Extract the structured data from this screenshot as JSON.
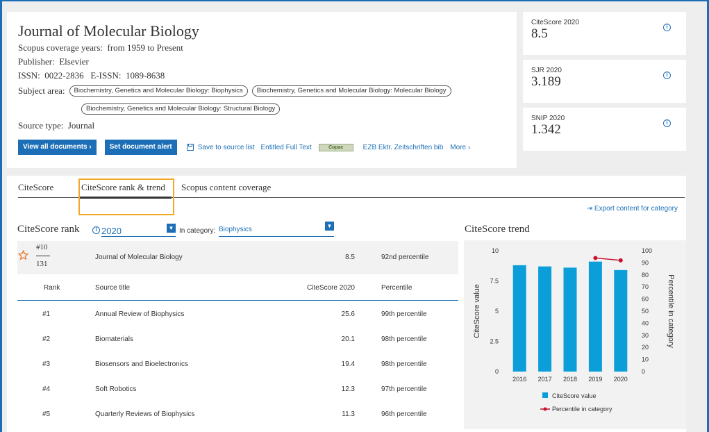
{
  "source": {
    "title": "Journal of Molecular Biology",
    "coverage_label": "Scopus coverage years:",
    "coverage_value": "from 1959 to Present",
    "publisher_label": "Publisher:",
    "publisher_value": "Elsevier",
    "issn_label": "ISSN:",
    "issn_value": "0022-2836",
    "eissn_label": "E-ISSN:",
    "eissn_value": "1089-8638",
    "subject_label": "Subject area:",
    "subjects": [
      "Biochemistry, Genetics and Molecular Biology: Biophysics",
      "Biochemistry, Genetics and Molecular Biology: Molecular Biology",
      "Biochemistry, Genetics and Molecular Biology: Structural Biology"
    ],
    "source_type_label": "Source type:",
    "source_type_value": "Journal"
  },
  "actions": {
    "view_all": "View all documents ›",
    "set_alert": "Set document alert",
    "save_to_list": "Save to source list",
    "entitled_full_text": "Entitled Full Text",
    "copac": "Copac",
    "ezb": "EZB Ektr. Zeitschriften bib",
    "more": "More ›"
  },
  "metrics": [
    {
      "label": "CiteScore 2020",
      "value": "8.5"
    },
    {
      "label": "SJR 2020",
      "value": "3.189"
    },
    {
      "label": "SNIP 2020",
      "value": "1.342"
    }
  ],
  "tabs": [
    "CiteScore",
    "CiteScore rank & trend",
    "Scopus content coverage"
  ],
  "export_link": "Export content for category",
  "rank": {
    "title": "CiteScore rank",
    "year": "2020",
    "category_label": "In category:",
    "category_value": "Biophysics",
    "current": {
      "rank": "#10",
      "total": "131",
      "title": "Journal of Molecular Biology",
      "score": "8.5",
      "percentile": "92nd percentile"
    },
    "headers": {
      "rank": "Rank",
      "title": "Source title",
      "score": "CiteScore 2020",
      "percentile": "Percentile"
    },
    "rows": [
      {
        "rank": "#1",
        "title": "Annual Review of Biophysics",
        "score": "25.6",
        "percentile": "99th percentile"
      },
      {
        "rank": "#2",
        "title": "Biomaterials",
        "score": "20.1",
        "percentile": "98th percentile"
      },
      {
        "rank": "#3",
        "title": "Biosensors and Bioelectronics",
        "score": "19.4",
        "percentile": "98th percentile"
      },
      {
        "rank": "#4",
        "title": "Soft Robotics",
        "score": "12.3",
        "percentile": "97th percentile"
      },
      {
        "rank": "#5",
        "title": "Quarterly Reviews of Biophysics",
        "score": "11.3",
        "percentile": "96th percentile"
      }
    ]
  },
  "trend": {
    "title": "CiteScore trend"
  },
  "colors": {
    "accent": "#1c6fb6",
    "bar": "#0b9ed9",
    "line": "#c8102e",
    "highlight": "#f2a827"
  },
  "icons": {
    "info": "info-icon",
    "star": "star-outline-icon",
    "save": "save-icon",
    "export": "export-icon",
    "dropdown": "chevron-down-icon"
  },
  "chart_data": {
    "type": "bar",
    "categories": [
      "2016",
      "2017",
      "2018",
      "2019",
      "2020"
    ],
    "series": [
      {
        "name": "CiteScore value",
        "type": "bar",
        "axis": "left",
        "values": [
          8.8,
          8.7,
          8.6,
          9.1,
          8.4
        ]
      },
      {
        "name": "Percentile in category",
        "type": "line",
        "axis": "right",
        "values": [
          null,
          null,
          null,
          94,
          92
        ]
      }
    ],
    "ylabel": "CiteScore value",
    "y2label": "Percentile in category",
    "ylim": [
      0,
      10
    ],
    "yticks": [
      "0",
      "2.5",
      "5",
      "7.5",
      "10"
    ],
    "y2lim": [
      0,
      100
    ],
    "y2ticks": [
      "0",
      "10",
      "20",
      "30",
      "40",
      "50",
      "60",
      "70",
      "80",
      "90",
      "100"
    ],
    "legend_position": "bottom"
  }
}
